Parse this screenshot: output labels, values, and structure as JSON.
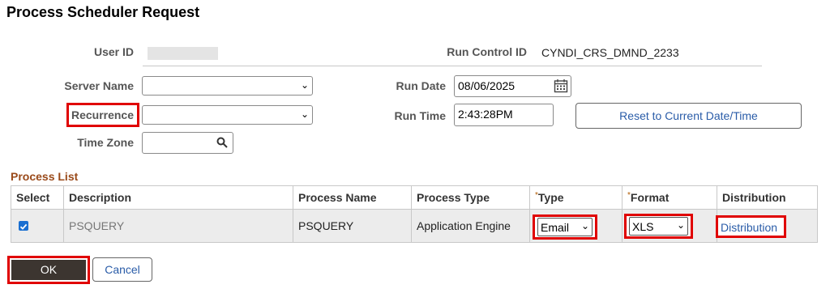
{
  "page_title": "Process Scheduler Request",
  "form": {
    "user_id_label": "User ID",
    "run_control_id_label": "Run Control ID",
    "run_control_id_value": "CYNDI_CRS_DMND_2233",
    "server_name_label": "Server Name",
    "recurrence_label": "Recurrence",
    "time_zone_label": "Time Zone",
    "run_date_label": "Run Date",
    "run_date_value": "08/06/2025",
    "run_time_label": "Run Time",
    "run_time_value": "2:43:28PM",
    "reset_button_label": "Reset to Current Date/Time"
  },
  "process_list": {
    "title": "Process List",
    "columns": [
      "Select",
      "Description",
      "Process Name",
      "Process Type",
      "Type",
      "Format",
      "Distribution"
    ],
    "required_marker": "*",
    "row": {
      "description": "PSQUERY",
      "process_name": "PSQUERY",
      "process_type": "Application Engine",
      "type_value": "Email",
      "format_value": "XLS",
      "distribution_link": "Distribution"
    }
  },
  "buttons": {
    "ok": "OK",
    "cancel": "Cancel"
  },
  "colors": {
    "highlight_red": "#e00000",
    "link_blue": "#2a5ca8",
    "section_brown": "#9a4a1a"
  }
}
